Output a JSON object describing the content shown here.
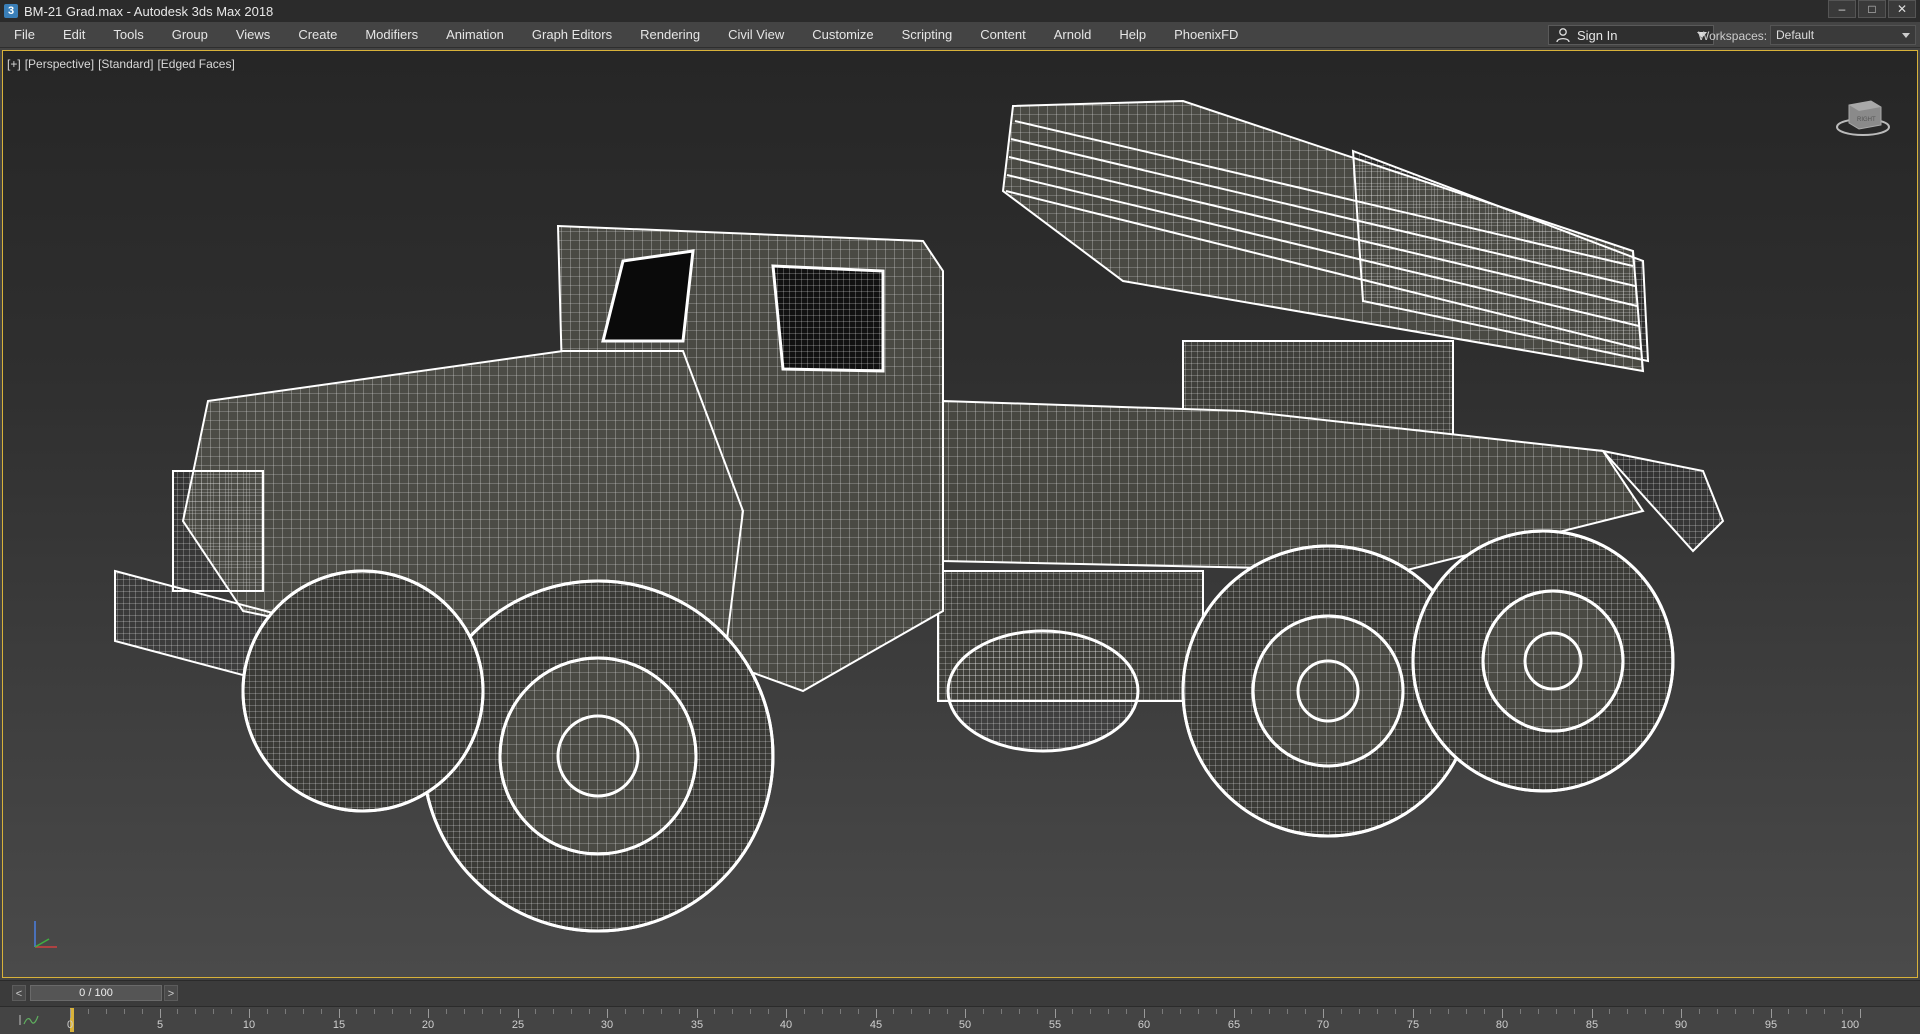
{
  "window": {
    "title": "BM-21 Grad.max - Autodesk 3ds Max 2018",
    "app_icon": "3ds-max-icon",
    "buttons": [
      "minimize",
      "maximize",
      "close"
    ]
  },
  "menubar": {
    "items": [
      "File",
      "Edit",
      "Tools",
      "Group",
      "Views",
      "Create",
      "Modifiers",
      "Animation",
      "Graph Editors",
      "Rendering",
      "Civil View",
      "Customize",
      "Scripting",
      "Content",
      "Arnold",
      "Help",
      "PhoenixFD"
    ]
  },
  "account": {
    "sign_in_label": "Sign In",
    "workspaces_label": "Workspaces:",
    "workspace_value": "Default"
  },
  "viewport": {
    "labels": [
      "[+]",
      "[Perspective]",
      "[Standard]",
      "[Edged Faces]"
    ],
    "content": "wireframe-truck-model",
    "viewcube_icon": "viewcube-icon",
    "axis_icon": "axis-tripod-icon",
    "active_border_color": "#d8b23a"
  },
  "timeslider": {
    "prev_label": "<",
    "next_label": ">",
    "frame_display": "0 / 100",
    "current_frame": 0,
    "total_frames": 100
  },
  "trackbar": {
    "tick_labels": [
      "0",
      "5",
      "10",
      "15",
      "20",
      "25",
      "30",
      "35",
      "40",
      "45",
      "50",
      "55",
      "60",
      "65",
      "70",
      "75",
      "80",
      "85",
      "90",
      "95",
      "100"
    ]
  }
}
